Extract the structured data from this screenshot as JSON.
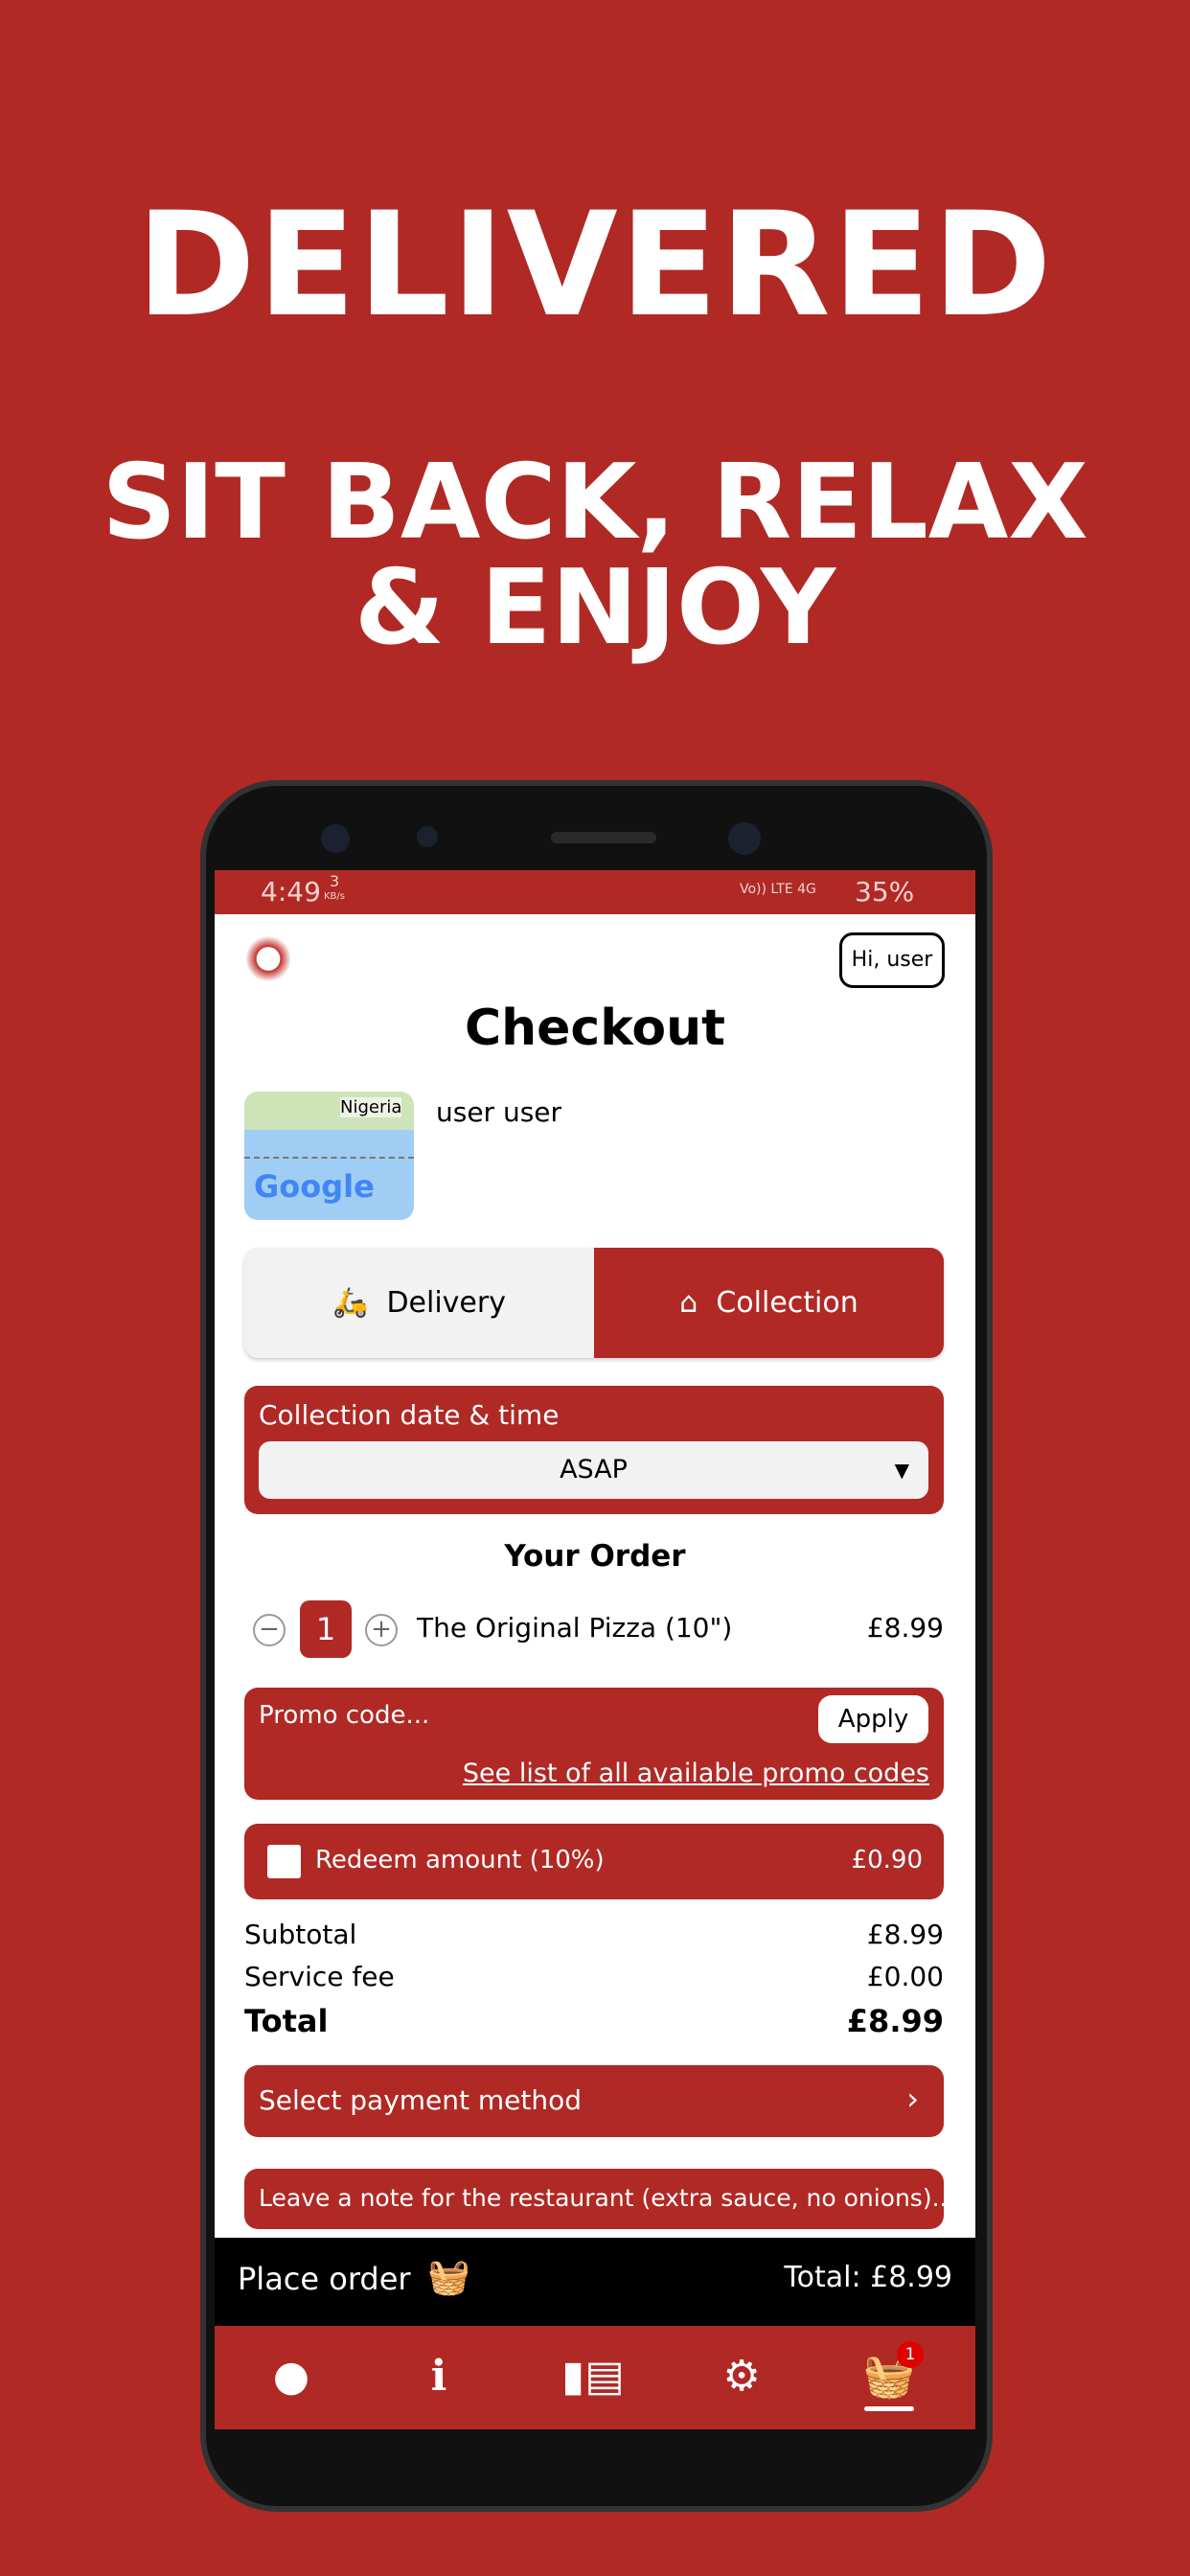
{
  "hero": {
    "title": "DELIVERED",
    "subtitle_line1": "SIT BACK, RELAX",
    "subtitle_line2": "& ENJOY"
  },
  "status_bar": {
    "time": "4:49",
    "speed_value": "3",
    "speed_unit": "KB/s",
    "network": "Vo)) LTE 4G",
    "battery": "35%"
  },
  "header": {
    "greeting_button": "Hi, user",
    "title": "Checkout"
  },
  "address": {
    "map_label": "Nigeria",
    "map_brand": "Google",
    "name": "user user"
  },
  "order_type": {
    "options": [
      {
        "label": "Delivery",
        "icon": "scooter-icon",
        "selected": false
      },
      {
        "label": "Collection",
        "icon": "store-icon",
        "selected": true
      }
    ]
  },
  "collection": {
    "label": "Collection date & time",
    "selected": "ASAP"
  },
  "your_order": {
    "heading": "Your Order",
    "items": [
      {
        "qty": "1",
        "name": "The Original Pizza (10\")",
        "price": "£8.99"
      }
    ]
  },
  "promo": {
    "placeholder": "Promo code...",
    "apply": "Apply",
    "link": "See list of all available promo codes"
  },
  "redeem": {
    "label": "Redeem amount (10%)",
    "amount": "£0.90",
    "checked": false
  },
  "totals": {
    "subtotal_label": "Subtotal",
    "subtotal": "£8.99",
    "service_label": "Service fee",
    "service": "£0.00",
    "total_label": "Total",
    "total": "£8.99"
  },
  "payment": {
    "label": "Select payment method"
  },
  "note": {
    "placeholder": "Leave a note for the restaurant (extra sauce, no onions).."
  },
  "place_order": {
    "label": "Place order",
    "total": "Total: £8.99"
  },
  "nav": {
    "items": [
      {
        "icon": "user-icon"
      },
      {
        "icon": "info-icon"
      },
      {
        "icon": "menu-icon"
      },
      {
        "icon": "gear-icon"
      },
      {
        "icon": "basket-icon",
        "badge": "1",
        "active": true
      }
    ]
  },
  "colors": {
    "brand": "#b02925",
    "badge": "#e00000"
  }
}
